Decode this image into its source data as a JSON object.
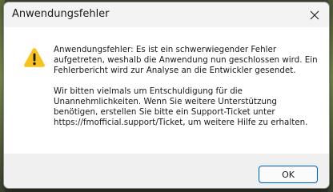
{
  "window": {
    "title": "Anwendungsfehler",
    "close_icon": "close-icon"
  },
  "message": {
    "icon": "warning-icon",
    "paragraph1": "Anwendungsfehler: Es ist ein schwerwiegender Fehler aufgetreten, weshalb die Anwendung nun geschlossen wird. Ein Fehlerbericht wird zur Analyse an die Entwickler gesendet.",
    "paragraph2": "Wir bitten vielmals um Entschuldigung für die Unannehmlichkeiten. Wenn Sie weitere Unterstützung benötigen, erstellen Sie bitte ein Support-Ticket unter https://fmofficial.support/Ticket, um weitere Hilfe zu erhalten."
  },
  "footer": {
    "ok_label": "OK"
  },
  "colors": {
    "warning_fill": "#f8c21c",
    "accent_border": "#0067c0"
  }
}
